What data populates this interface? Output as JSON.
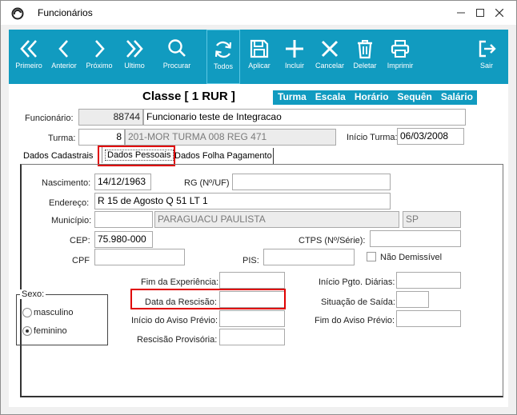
{
  "window": {
    "title": "Funcionários"
  },
  "toolbar": {
    "buttons": [
      {
        "id": "primeiro",
        "label": "Primeiro",
        "icon": "double-chevron-left-icon"
      },
      {
        "id": "anterior",
        "label": "Anterior",
        "icon": "chevron-left-icon"
      },
      {
        "id": "proximo",
        "label": "Próximo",
        "icon": "chevron-right-icon"
      },
      {
        "id": "ultimo",
        "label": "Ultimo",
        "icon": "double-chevron-right-icon"
      },
      {
        "id": "procurar",
        "label": "Procurar",
        "icon": "search-icon"
      },
      {
        "id": "todos",
        "label": "Todos",
        "icon": "refresh-icon"
      },
      {
        "id": "aplicar",
        "label": "Aplicar",
        "icon": "save-icon"
      },
      {
        "id": "incluir",
        "label": "Incluir",
        "icon": "plus-icon"
      },
      {
        "id": "cancelar",
        "label": "Cancelar",
        "icon": "close-icon"
      },
      {
        "id": "deletar",
        "label": "Deletar",
        "icon": "trash-icon"
      },
      {
        "id": "imprimir",
        "label": "Imprimir",
        "icon": "printer-icon"
      },
      {
        "id": "sair",
        "label": "Sair",
        "icon": "exit-icon"
      }
    ]
  },
  "header": {
    "classe": "Classe [ 1 RUR ]",
    "tabs": [
      "Turma",
      "Escala",
      "Horário",
      "Sequên",
      "Salário"
    ]
  },
  "form": {
    "funcionario_label": "Funcionário:",
    "funcionario_id": "88744",
    "funcionario_nome": "Funcionario teste de Integracao",
    "turma_label": "Turma:",
    "turma_num": "8",
    "turma_desc": "201-MOR TURMA 008 REG 471",
    "inicio_turma_label": "Início Turma:",
    "inicio_turma": "06/03/2008"
  },
  "page_tabs": [
    "Dados Cadastrais",
    "Dados Pessoais",
    "Dados Folha Pagamento"
  ],
  "pessoais": {
    "nascimento_label": "Nascimento:",
    "nascimento": "14/12/1963",
    "rg_label": "RG (Nº/UF)",
    "rg": "",
    "endereco_label": "Endereço:",
    "endereco": "R 15 de Agosto Q 51 LT 1",
    "municipio_label": "Município:",
    "municipio_code": "",
    "municipio_nome": "PARAGUACU PAULISTA",
    "uf": "SP",
    "cep_label": "CEP:",
    "cep": "75.980-000",
    "ctps_label": "CTPS (Nº/Série):",
    "ctps": "",
    "cpf_label": "CPF",
    "cpf": "",
    "pis_label": "PIS:",
    "pis": "",
    "nao_demissivel_label": "Não Demissível",
    "sexo_label": "Sexo:",
    "sexo_options": [
      "masculino",
      "feminino"
    ],
    "sexo_selected": "feminino",
    "fim_experiencia_label": "Fim da Experiência:",
    "fim_experiencia": "",
    "data_rescisao_label": "Data da Rescisão:",
    "data_rescisao": "",
    "inicio_aviso_label": "Início do Aviso Prévio:",
    "inicio_aviso": "",
    "rescisao_provisoria_label": "Rescisão Provisória:",
    "rescisao_provisoria": "",
    "inicio_pgto_label": "Início Pgto. Diárias:",
    "inicio_pgto": "",
    "situacao_saida_label": "Situação de Saída:",
    "situacao_saida": "",
    "fim_aviso_label": "Fim do Aviso Prévio:",
    "fim_aviso": ""
  },
  "colors": {
    "toolbar": "#119bc0",
    "highlight": "#e00000"
  }
}
